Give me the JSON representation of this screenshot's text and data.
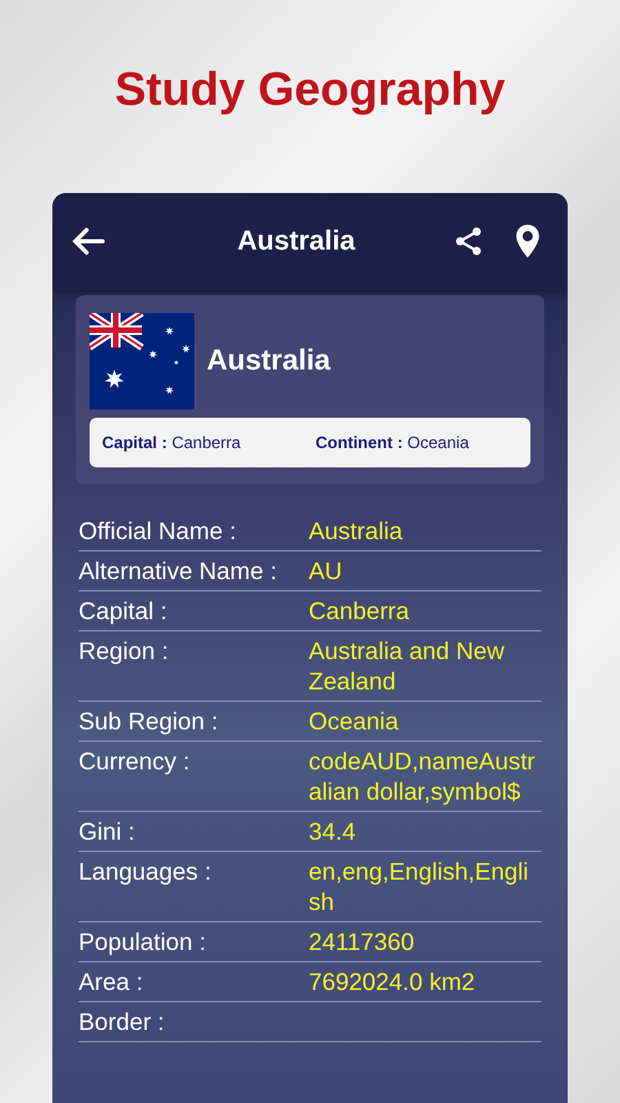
{
  "headline": "Study Geography",
  "app_bar": {
    "title": "Australia"
  },
  "country_card": {
    "name": "Australia",
    "capital_label": "Capital :",
    "capital": "Canberra",
    "continent_label": "Continent :",
    "continent": "Oceania"
  },
  "details": [
    {
      "label": "Official Name :",
      "value": "Australia"
    },
    {
      "label": "Alternative Name :",
      "value": "AU"
    },
    {
      "label": "Capital :",
      "value": "Canberra"
    },
    {
      "label": "Region :",
      "value": "Australia and New Zealand"
    },
    {
      "label": "Sub Region :",
      "value": "Oceania"
    },
    {
      "label": "Currency :",
      "value": "codeAUD,nameAustralian dollar,symbol$"
    },
    {
      "label": "Gini :",
      "value": "34.4"
    },
    {
      "label": "Languages :",
      "value": "en,eng,English,English"
    },
    {
      "label": "Population :",
      "value": "24117360"
    },
    {
      "label": "Area :",
      "value": "7692024.0 km2"
    },
    {
      "label": "Border :"
    }
  ]
}
